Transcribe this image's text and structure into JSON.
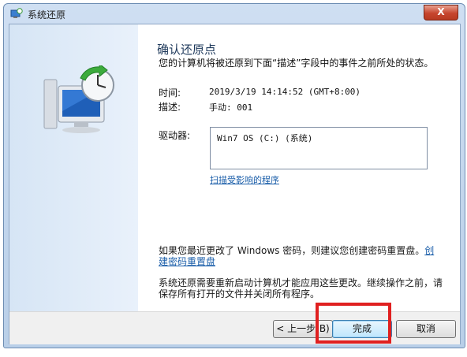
{
  "window": {
    "title": "系统还原",
    "close_glyph": "X"
  },
  "page": {
    "heading": "确认还原点",
    "description": "您的计算机将被还原到下面“描述”字段中的事件之前所处的状态。"
  },
  "details": {
    "time_label": "时间:",
    "time_value": "2019/3/19 14:14:52 (GMT+8:00)",
    "desc_label": "描述:",
    "desc_value": "手动: 001",
    "drives_label": "驱动器:",
    "drives": [
      "Win7 OS (C:) (系统)"
    ]
  },
  "links": {
    "scan_programs": "扫描受影响的程序"
  },
  "password_note": {
    "text": "如果您最近更改了 Windows 密码，则建议您创建密码重置盘。",
    "link": "创建密码重置盘"
  },
  "warning": "系统还原需要重新启动计算机才能应用这些更改。继续操作之前，请保存所有打开的文件并关闭所有程序。",
  "buttons": {
    "back": "< 上一步(B)",
    "finish": "完成",
    "cancel": "取消"
  },
  "icons": [
    "system-restore-icon",
    "restore-clock-illustration"
  ],
  "colors": {
    "accent_link": "#1c5faa",
    "heading": "#1e395b",
    "highlight": "#e02020"
  }
}
